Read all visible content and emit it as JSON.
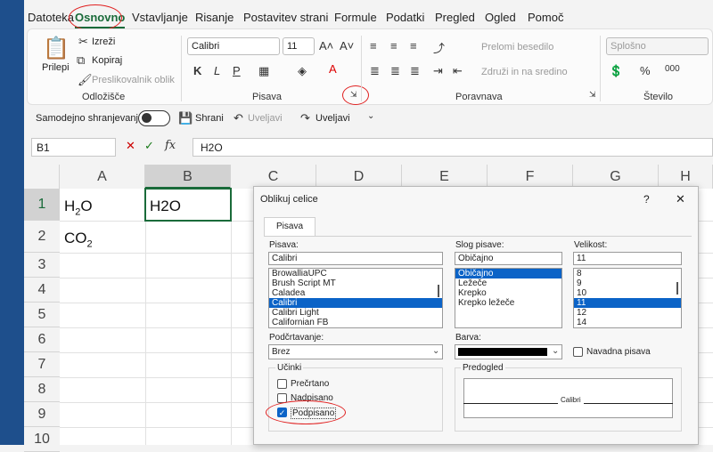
{
  "menu": [
    "Datoteka",
    "Osnovno",
    "Vstavljanje",
    "Risanje",
    "Postavitev strani",
    "Formule",
    "Podatki",
    "Pregled",
    "Ogled",
    "Pomoč"
  ],
  "clipboard": {
    "paste": "Prilepi",
    "cut": "Izreži",
    "copy": "Kopiraj",
    "painter": "Preslikovalnik oblik",
    "group": "Odložišče"
  },
  "font": {
    "name": "Calibri",
    "size": "11",
    "bold": "K",
    "italic": "L",
    "underline": "P",
    "group": "Pisava"
  },
  "alignment": {
    "wrap": "Prelomi besedilo",
    "merge": "Združi in na sredino",
    "group": "Poravnava"
  },
  "number": {
    "format": "Splošno",
    "group": "Število"
  },
  "qat": {
    "autosave": "Samodejno shranjevanje",
    "save": "Shrani",
    "undo": "Uveljavi",
    "redo": "Uveljavi"
  },
  "formula": {
    "cell_ref": "B1",
    "content": "H2O"
  },
  "columns": [
    "A",
    "B",
    "C",
    "D",
    "E",
    "F",
    "G",
    "H"
  ],
  "rows": [
    "1",
    "2",
    "3",
    "4",
    "5",
    "6",
    "7",
    "8",
    "9",
    "10"
  ],
  "cells": {
    "a1_main": "H",
    "a1_sub": "2",
    "a1_tail": "O",
    "b1": "H2O",
    "a2_main": "CO",
    "a2_sub": "2"
  },
  "dialog": {
    "title": "Oblikuj celice",
    "help": "?",
    "close": "✕",
    "tab": "Pisava",
    "font_label": "Pisava:",
    "font_value": "Calibri",
    "font_list": [
      "BrowalliaUPC",
      "Brush Script MT",
      "Caladea",
      "Calibri",
      "Calibri Light",
      "Californian FB"
    ],
    "style_label": "Slog pisave:",
    "style_value": "Običajno",
    "style_list": [
      "Običajno",
      "Ležeče",
      "Krepko",
      "Krepko ležeče"
    ],
    "size_label": "Velikost:",
    "size_value": "11",
    "size_list": [
      "8",
      "9",
      "10",
      "11",
      "12",
      "14"
    ],
    "underline_label": "Podčrtavanje:",
    "underline_value": "Brez",
    "color_label": "Barva:",
    "normal_font": "Navadna pisava",
    "effects_label": "Učinki",
    "strike": "Prečrtano",
    "superscript": "Nadpisano",
    "subscript": "Podpisano",
    "preview_label": "Predogled",
    "preview_text": "Calibri"
  }
}
